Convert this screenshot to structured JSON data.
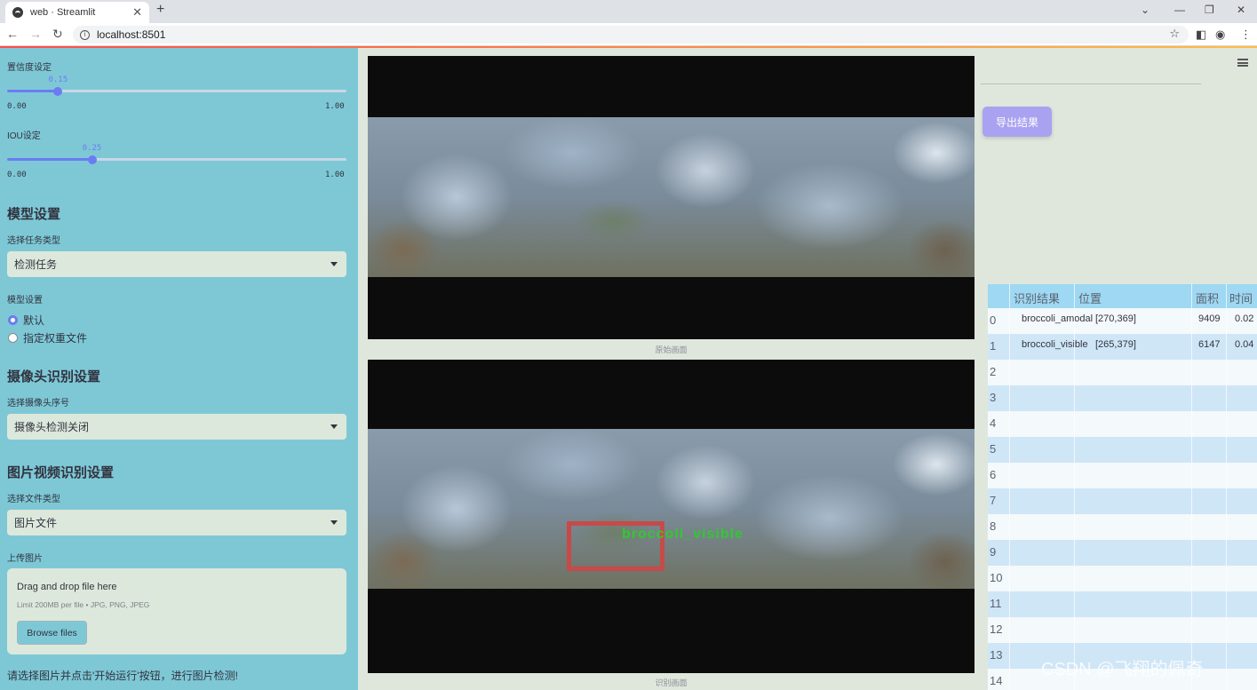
{
  "browser": {
    "tab_title": "web · Streamlit",
    "new_tab": "+",
    "url": "localhost:8501"
  },
  "sidebar": {
    "conf_label": "置信度设定",
    "conf_value": "0.15",
    "conf_fraction": 0.15,
    "conf_min": "0.00",
    "conf_max": "1.00",
    "iou_label": "IOU设定",
    "iou_value": "0.25",
    "iou_fraction": 0.25,
    "iou_min": "0.00",
    "iou_max": "1.00",
    "model_heading": "模型设置",
    "task_label": "选择任务类型",
    "task_value": "检测任务",
    "model_label": "模型设置",
    "radio_default": "默认",
    "radio_custom": "指定权重文件",
    "camera_heading": "摄像头识别设置",
    "camera_label": "选择摄像头序号",
    "camera_value": "摄像头检测关闭",
    "media_heading": "图片视频识别设置",
    "filetype_label": "选择文件类型",
    "filetype_value": "图片文件",
    "upload_label": "上传图片",
    "drop_text": "Drag and drop file here",
    "limit_text": "Limit 200MB per file • JPG, PNG, JPEG",
    "browse_label": "Browse files",
    "hint": "请选择图片并点击'开始运行'按钮，进行图片检测!"
  },
  "main": {
    "original_caption": "原始画面",
    "result_caption": "识别画面",
    "detection_label": "broccoli_visible",
    "export_label": "导出结果"
  },
  "table": {
    "headers": [
      "识别结果",
      "位置",
      "面积",
      "时间"
    ],
    "rows": [
      {
        "index": "0",
        "result": "broccoli_amodal",
        "position": "[270,369]",
        "area": "9409",
        "time": "0.02"
      },
      {
        "index": "1",
        "result": "broccoli_visible",
        "position": "[265,379]",
        "area": "6147",
        "time": "0.04"
      }
    ],
    "empty_indices": [
      "2",
      "3",
      "4",
      "5",
      "6",
      "7",
      "8",
      "9",
      "10",
      "11",
      "12",
      "13",
      "14"
    ]
  },
  "watermark": "CSDN @飞翔的佩奇",
  "colors": {
    "sidebar_bg": "#7ec8d6",
    "accent": "#6b7cf2",
    "export_button": "#a9a2f0",
    "bbox": "#c74a48",
    "bbox_label": "#32c832"
  }
}
